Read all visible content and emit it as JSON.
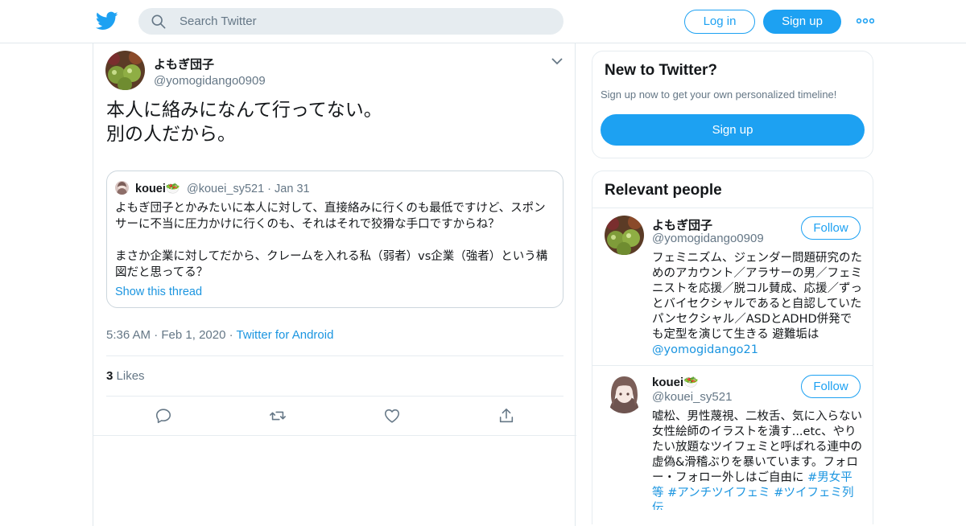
{
  "header": {
    "search_placeholder": "Search Twitter",
    "login_label": "Log in",
    "signup_label": "Sign up"
  },
  "tweet": {
    "author_name": "よもぎ団子",
    "author_handle": "@yomogidango0909",
    "text_line1": "本人に絡みになんて行ってない。",
    "text_line2": "別の人だから。",
    "timestamp": "5:36 AM",
    "date": "Feb 1, 2020",
    "source": "Twitter for Android",
    "likes_count": "3",
    "likes_label": "Likes"
  },
  "quote": {
    "author_name": "kouei",
    "author_emoji": "🥗",
    "author_handle": "@kouei_sy521",
    "date": "Jan 31",
    "text_line1": "よもぎ団子とかみたいに本人に対して、直接絡みに行くのも最低ですけど、スポンサーに不当に圧力かけに行くのも、それはそれで狡猾な手口ですからね？",
    "text_line2": "まさか企業に対してだから、クレームを入れる私（弱者）vs企業（強者）という構図だと思ってる？",
    "show_thread": "Show this thread"
  },
  "sidebar": {
    "new_title": "New to Twitter?",
    "new_subtitle": "Sign up now to get your own personalized timeline!",
    "new_signup": "Sign up",
    "relevant_title": "Relevant people",
    "people": [
      {
        "name": "よもぎ団子",
        "handle": "@yomogidango0909",
        "follow": "Follow",
        "bio": "フェミニズム、ジェンダー問題研究のためのアカウント／アラサーの男／フェミニストを応援／脱コル賛成、応援／ずっとバイセクシャルであると自認していたパンセクシャル／ASDとADHD併発でも定型を演じて生きる 避難垢は",
        "bio_link": "@yomogidango21"
      },
      {
        "name": "kouei",
        "emoji": "🥗",
        "handle": "@kouei_sy521",
        "follow": "Follow",
        "bio": "嘘松、男性蔑視、二枚舌、気に入らない女性絵師のイラストを潰す...etc、やりたい放題なツイフェミと呼ばれる連中の虚偽&滑稽ぶりを暴いています。フォロー・フォロー外しはご自由に",
        "tags": [
          "#男女平等",
          "#アンチツイフェミ",
          "#ツイフェミ列伝"
        ]
      }
    ]
  },
  "colors": {
    "accent": "#1da1f2",
    "link": "#1b95e0",
    "muted": "#657786"
  }
}
